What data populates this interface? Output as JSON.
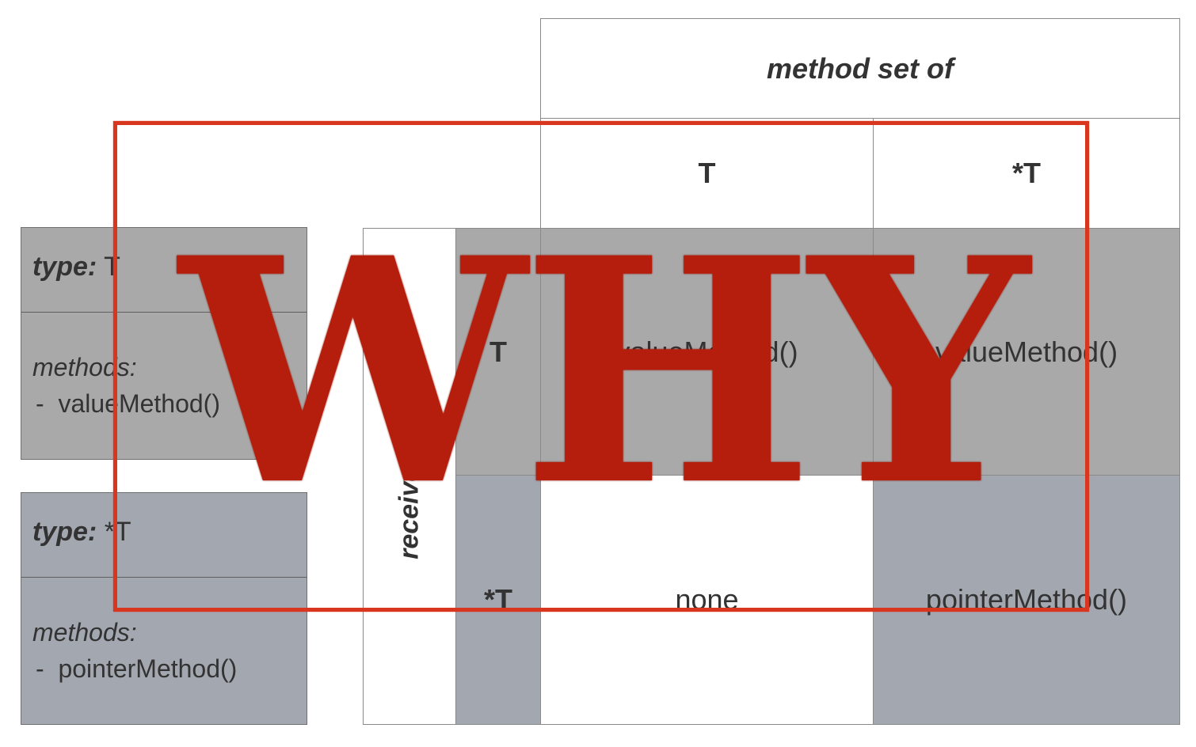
{
  "header": {
    "title": "method set of",
    "col_value": "T",
    "col_pointer": "*T"
  },
  "row_header": {
    "label": "receiver type",
    "row_value": "T",
    "row_pointer": "*T"
  },
  "cells": {
    "value_value": "valueMethod()",
    "value_pointer": "valueMethod()",
    "pointer_value": "none",
    "pointer_pointer": "pointerMethod()"
  },
  "types": [
    {
      "label": "type:",
      "name": "T",
      "methods_label": "methods:",
      "methods": [
        "valueMethod()"
      ],
      "color": "#a9a9a9"
    },
    {
      "label": "type:",
      "name": "*T",
      "methods_label": "methods:",
      "methods": [
        "pointerMethod()"
      ],
      "color": "#a3a7b0"
    }
  ],
  "overlay": {
    "stamp_text": "WHY",
    "color": "#b51e0d"
  }
}
